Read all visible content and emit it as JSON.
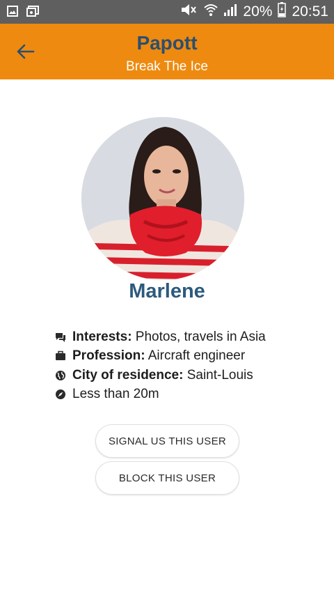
{
  "status_bar": {
    "battery": "20%",
    "time": "20:51",
    "left_icons": [
      "image-icon",
      "gallery-icon"
    ],
    "right_icons": [
      "mute-icon",
      "wifi-icon",
      "signal-icon",
      "battery-icon"
    ]
  },
  "app_bar": {
    "title": "Papott",
    "subtitle": "Break The Ice",
    "back_icon": "arrow-left-icon",
    "background": "#EE8A10",
    "title_color": "#2C4F6E"
  },
  "profile": {
    "name": "Marlene",
    "name_color": "#2C5A7D",
    "details": [
      {
        "icon": "chat-icon",
        "label": "Interests:",
        "value": " Photos, travels in Asia"
      },
      {
        "icon": "briefcase-icon",
        "label": "Profession:",
        "value": " Aircraft engineer"
      },
      {
        "icon": "globe-icon",
        "label": "City of residence:",
        "value": " Saint-Louis"
      },
      {
        "icon": "compass-icon",
        "label": "",
        "value": "Less than 20m"
      }
    ]
  },
  "actions": {
    "signal_label": "SIGNAL US THIS USER",
    "block_label": "BLOCK THIS USER"
  }
}
